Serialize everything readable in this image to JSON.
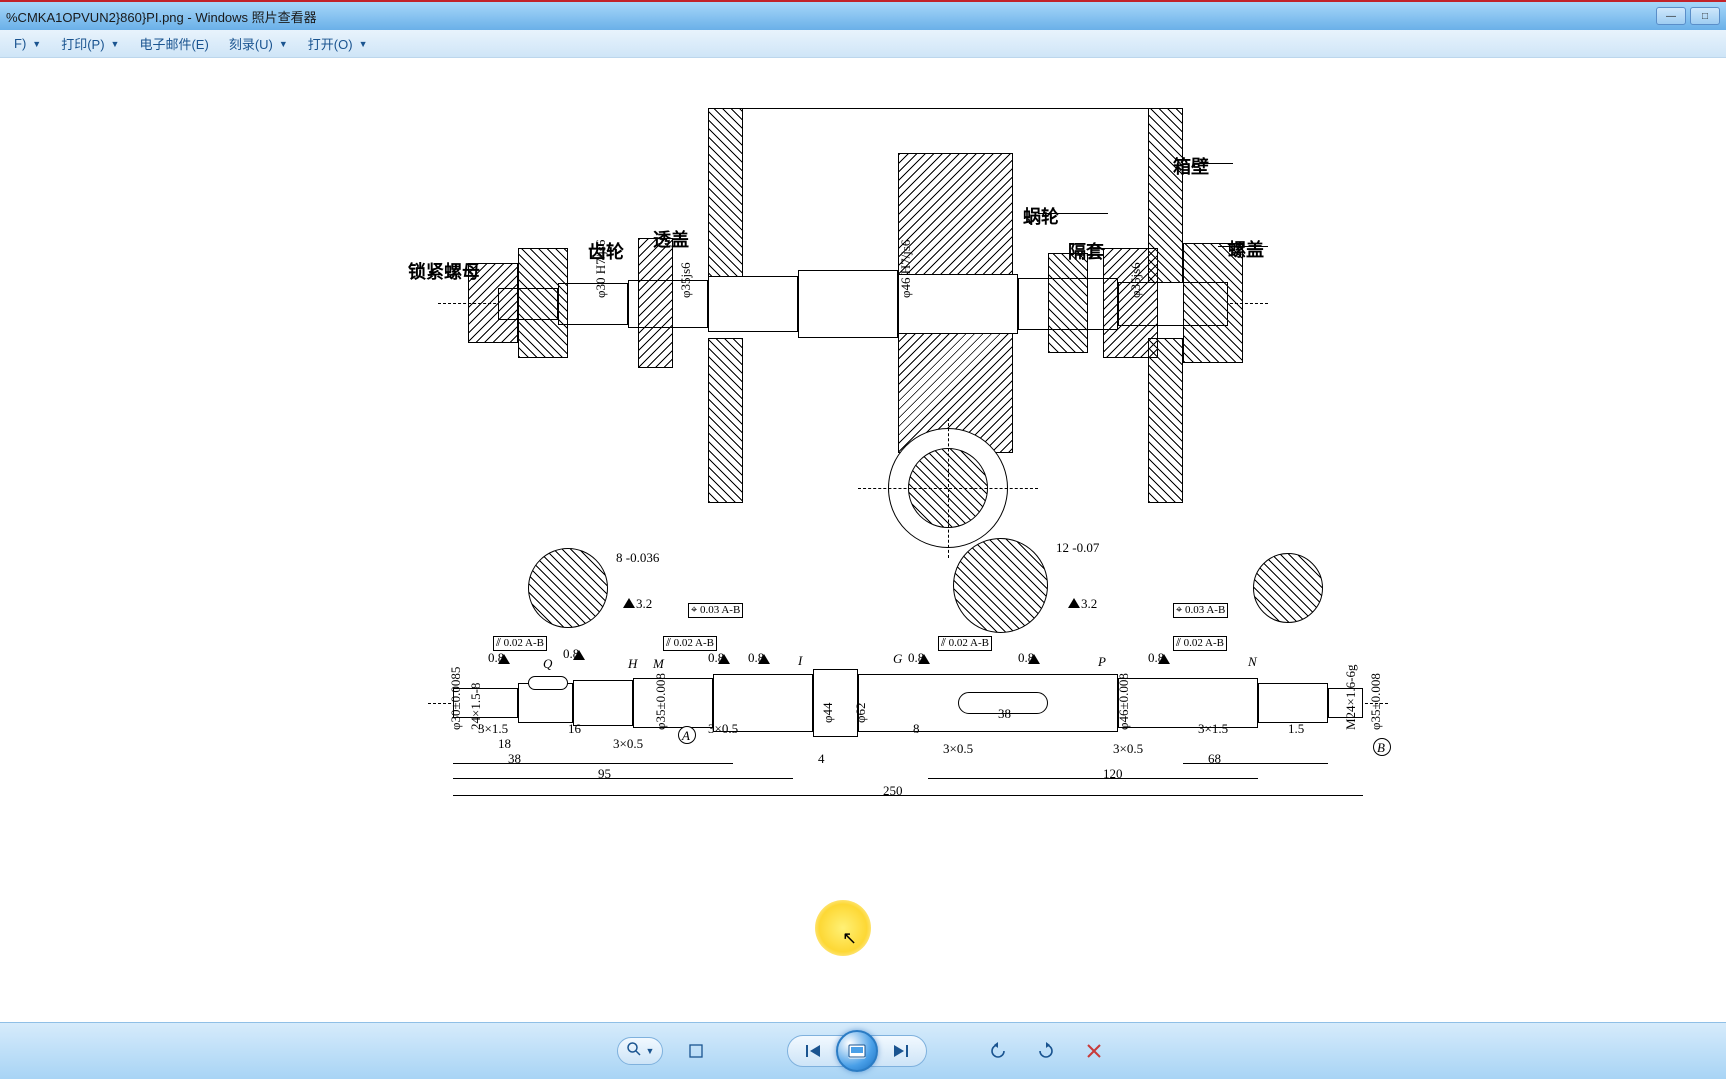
{
  "window": {
    "title": "%CMKA1OPVUN2}860}PI.png - Windows 照片查看器",
    "minimize": "—",
    "maximize": "□",
    "close": "✕"
  },
  "menu": {
    "file": "F)",
    "print": "打印(P)",
    "email": "电子邮件(E)",
    "burn": "刻录(U)",
    "open": "打开(O)"
  },
  "drawing_labels": {
    "box_wall": "箱壁",
    "worm_wheel": "蜗轮",
    "sleeve": "隔套",
    "screw_cap": "螺盖",
    "gear": "齿轮",
    "transparent_cover": "透盖",
    "lock_nut": "锁紧螺母"
  },
  "drawing_fits": {
    "fit30": "φ30 H7/js6",
    "fit35": "φ35js6",
    "fit46": "φ46 H7/js6",
    "fit35b": "φ35js6"
  },
  "tolerances": {
    "t003a": "⌖ 0.03 A-B",
    "t003b": "⌖ 0.03 A-B",
    "t002_1": "⫽ 0.02 A-B",
    "t002_2": "⫽ 0.02 A-B",
    "t002_3": "⫽ 0.02 A-B",
    "t002_4": "⫽ 0.02 A-B"
  },
  "surface_finish": {
    "ra08": "0.8",
    "ra32": "3.2"
  },
  "section_letters": {
    "Q": "Q",
    "H": "H",
    "M": "M",
    "I": "I",
    "G": "G",
    "P": "P",
    "N": "N",
    "A": "A",
    "B": "B"
  },
  "dimensions": {
    "d30": "φ30±0.0085",
    "thread24": "24×1.5-8",
    "d35_008": "φ35±0.008",
    "d44": "φ44",
    "d62": "φ62",
    "d46_008": "φ46±0.008",
    "thread_m24": "M24×1.6-6g",
    "d35_008b": "φ35±0.008",
    "key8": "8 -0.036",
    "key12": "12 -0.07",
    "l3x15a": "3×1.5",
    "l18": "18",
    "l16": "16",
    "l3x05a": "3×0.5",
    "l38": "38",
    "l95": "95",
    "l3x05b": "3×0.5",
    "l4": "4",
    "l8": "8",
    "l38b": "38",
    "l3x05c": "3×0.5",
    "l3x05d": "3×0.5",
    "l120": "120",
    "l3x15b": "3×1.5",
    "l15": "1.5",
    "l68": "68",
    "l250": "250"
  },
  "toolbar": {
    "zoom": "🔍",
    "fit": "⛶",
    "prev": "⏮",
    "slideshow": "▦",
    "next": "⏭",
    "rotate_ccw": "↺",
    "rotate_cw": "↻",
    "delete": "✕"
  }
}
